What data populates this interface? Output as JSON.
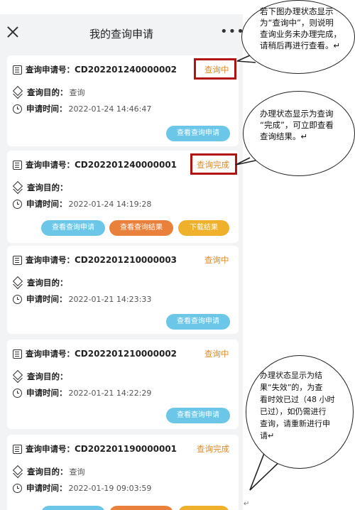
{
  "nav": {
    "title": "我的查询申请",
    "more": "•••"
  },
  "labels": {
    "no": "查询申请号：",
    "purpose": "查询目的：",
    "time": "申请时间："
  },
  "cards": [
    {
      "no": "CD202201240000002",
      "status": "查询中",
      "purpose": "查询",
      "time": "2022-01-24 14:46:47",
      "buttons": [
        "查看查询申请"
      ]
    },
    {
      "no": "CD202201240000001",
      "status": "查询完成",
      "purpose": "",
      "time": "2022-01-24 14:19:28",
      "buttons": [
        "查看查询申请",
        "查看查询结果",
        "下载结果"
      ]
    },
    {
      "no": "CD202201210000003",
      "status": "查询中",
      "purpose": "",
      "time": "2022-01-21 14:23:33",
      "buttons": [
        "查看查询申请"
      ]
    },
    {
      "no": "CD202201210000002",
      "status": "查询中",
      "purpose": "",
      "time": "2022-01-21 14:22:29",
      "buttons": [
        "查看查询申请"
      ]
    },
    {
      "no": "CD202201190000001",
      "status": "查询完成",
      "purpose": "查询",
      "time": "2022-01-19 09:03:59",
      "buttons": []
    }
  ],
  "callouts": {
    "c1": [
      "若下图办理状态显示",
      "为“查询中”，则说明",
      "查询业务未办理完成，",
      "请稍后再进行查看。↵"
    ],
    "c2": [
      "办理状态显示为查询",
      "“完成”，可立即查看",
      "查询结果。↵"
    ],
    "c3": [
      "办理状态显示为结",
      "果“失效”的，为查",
      "看时效已过（48 小时",
      "已过），如仍需进行",
      "查询，请重新进行申",
      "请↵"
    ]
  },
  "return_mark": "↵",
  "colors": {
    "status": "#e08a2c",
    "btn_blue": "#6cc6e8",
    "btn_orange": "#e9813d",
    "btn_yellow": "#efb02c",
    "highlight_box": "#b11313"
  }
}
